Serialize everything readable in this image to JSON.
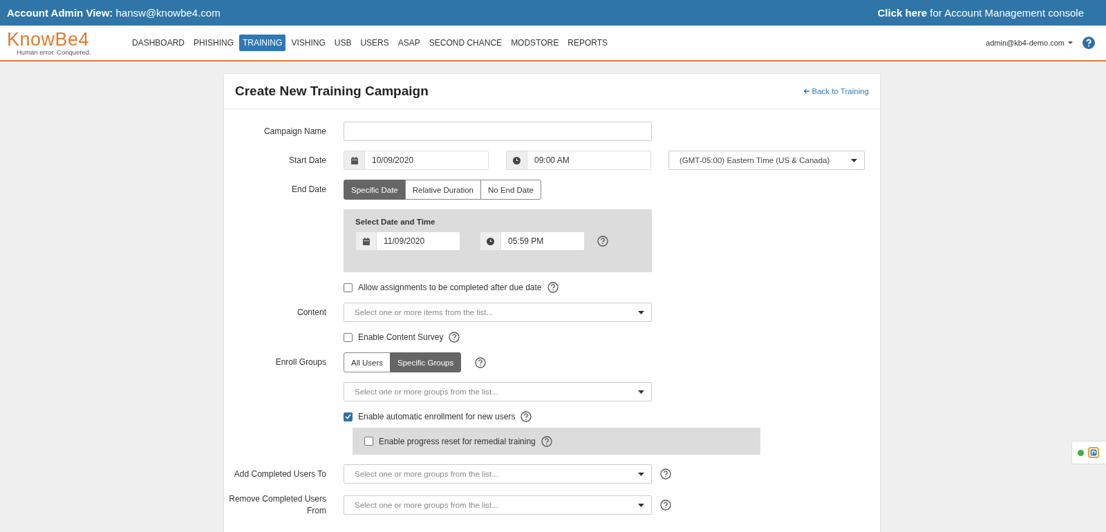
{
  "top_banner": {
    "title": "Account Admin View:",
    "account": "hansw@knowbe4.com",
    "link": "Click here",
    "link_suffix": "for Account Management console"
  },
  "logo": {
    "name": "KnowBe4",
    "tagline": "Human error. Conquered."
  },
  "nav": [
    {
      "label": "DASHBOARD",
      "selected": false
    },
    {
      "label": "PHISHING",
      "selected": false
    },
    {
      "label": "TRAINING",
      "selected": true
    },
    {
      "label": "VISHING",
      "selected": false
    },
    {
      "label": "USB",
      "selected": false
    },
    {
      "label": "USERS",
      "selected": false
    },
    {
      "label": "ASAP",
      "selected": false
    },
    {
      "label": "SECOND CHANCE",
      "selected": false
    },
    {
      "label": "MODSTORE",
      "selected": false
    },
    {
      "label": "REPORTS",
      "selected": false
    }
  ],
  "user_menu": "admin@kb4-demo.com",
  "page": {
    "title": "Create New Training Campaign",
    "back_link": "Back to Training"
  },
  "form": {
    "campaign_name": {
      "label": "Campaign Name"
    },
    "start_date": {
      "label": "Start Date",
      "date": "10/09/2020",
      "time": "09:00 AM",
      "timezone": "(GMT-05:00) Eastern Time (US & Canada)"
    },
    "end_date": {
      "label": "End Date",
      "options": [
        {
          "label": "Specific Date",
          "selected": true
        },
        {
          "label": "Relative Duration",
          "selected": false
        },
        {
          "label": "No End Date",
          "selected": false
        }
      ],
      "panel": {
        "title": "Select Date and Time",
        "date": "11/09/2020",
        "time": "05:59 PM"
      }
    },
    "allow_after_due": {
      "label": "Allow assignments to be completed after due date",
      "checked": false
    },
    "content": {
      "label": "Content",
      "placeholder": "Select one or more items from the list..."
    },
    "content_survey": {
      "label": "Enable Content Survey",
      "checked": false
    },
    "enroll_groups": {
      "label": "Enroll Groups",
      "options": [
        {
          "label": "All Users",
          "selected": false
        },
        {
          "label": "Specific Groups",
          "selected": true
        }
      ],
      "placeholder": "Select one or more groups from the list..."
    },
    "auto_enrollment": {
      "label": "Enable automatic enrollment for new users",
      "checked": true
    },
    "progress_reset": {
      "label": "Enable progress reset for remedial training",
      "checked": false
    },
    "add_completed": {
      "label": "Add Completed Users To",
      "placeholder": "Select one or more groups from the list..."
    },
    "remove_completed": {
      "label": "Remove Completed Users From",
      "placeholder": "Select one or more groups from the list..."
    }
  }
}
